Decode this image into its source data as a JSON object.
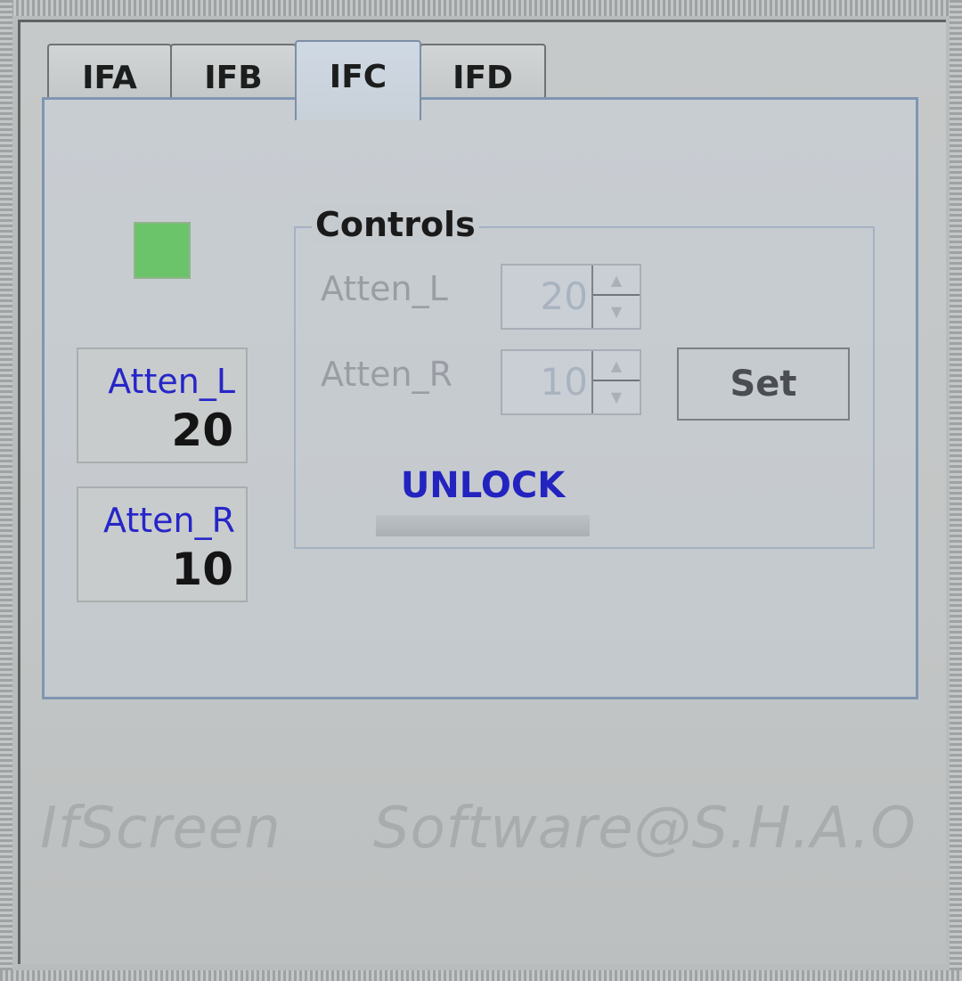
{
  "tabs": [
    {
      "label": "IFA",
      "active": false
    },
    {
      "label": "IFB",
      "active": false
    },
    {
      "label": "IFC",
      "active": true
    },
    {
      "label": "IFD",
      "active": false
    }
  ],
  "status": {
    "color": "#6cc46a"
  },
  "readouts": {
    "atten_l": {
      "label": "Atten_L",
      "value": "20"
    },
    "atten_r": {
      "label": "Atten_R",
      "value": "10"
    }
  },
  "controls": {
    "title": "Controls",
    "atten_l_label": "Atten_L",
    "atten_l_value": "20",
    "atten_r_label": "Atten_R",
    "atten_r_value": "10",
    "set_label": "Set",
    "unlock_label": "UNLOCK"
  },
  "footer": {
    "app_name": "IfScreen",
    "credit": "Software@S.H.A.O"
  },
  "colors": {
    "readout_label": "#2626c8",
    "unlock": "#2323c0",
    "panel_border": "#7f96b2"
  }
}
